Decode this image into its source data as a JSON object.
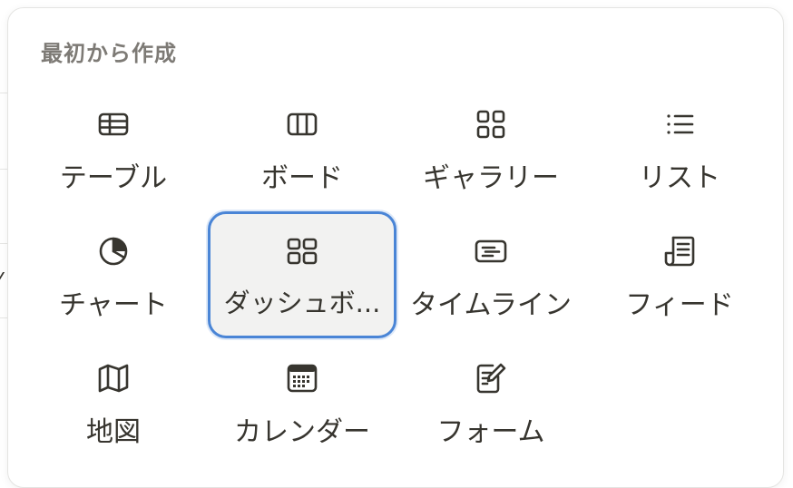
{
  "section": {
    "title": "最初から作成"
  },
  "tiles": [
    {
      "label": "テーブル",
      "icon": "table-icon"
    },
    {
      "label": "ボード",
      "icon": "board-icon"
    },
    {
      "label": "ギャラリー",
      "icon": "gallery-icon"
    },
    {
      "label": "リスト",
      "icon": "list-icon"
    },
    {
      "label": "チャート",
      "icon": "chart-icon"
    },
    {
      "label": "ダッシュボ...",
      "icon": "dashboard-icon",
      "selected": true
    },
    {
      "label": "タイムライン",
      "icon": "timeline-icon"
    },
    {
      "label": "フィード",
      "icon": "feed-icon"
    },
    {
      "label": "地図",
      "icon": "map-icon"
    },
    {
      "label": "カレンダー",
      "icon": "calendar-icon"
    },
    {
      "label": "フォーム",
      "icon": "form-icon"
    }
  ],
  "colors": {
    "accent": "#4a85d6",
    "text": "#37352f",
    "muted": "#7d7a75",
    "selected_bg": "#f2f2f1"
  }
}
